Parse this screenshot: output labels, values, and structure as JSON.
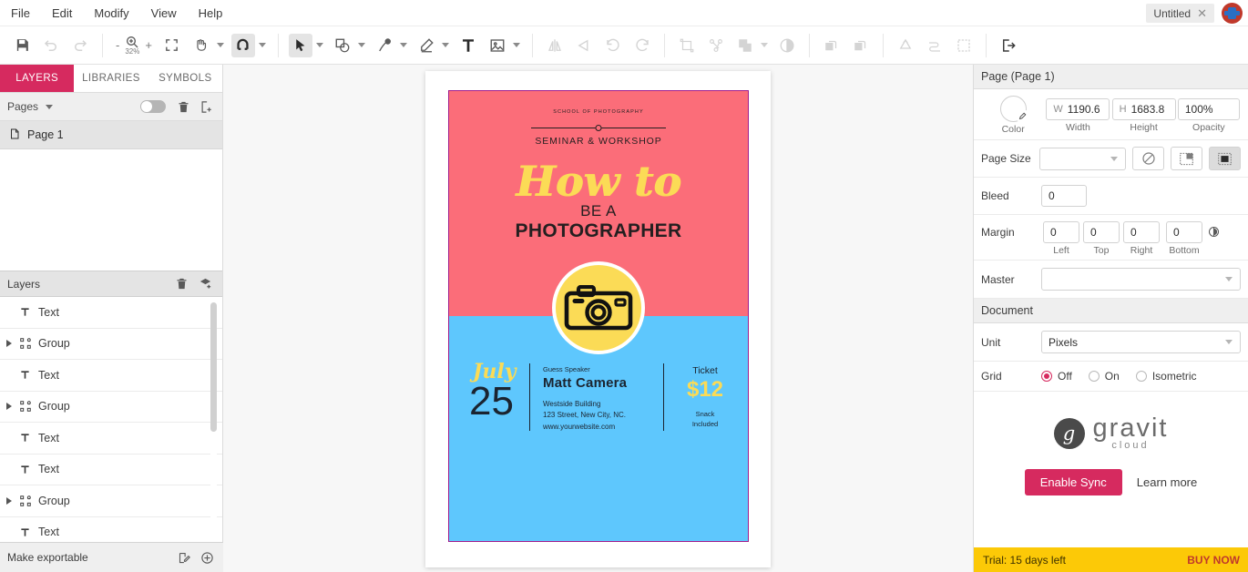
{
  "menubar": {
    "items": [
      "File",
      "Edit",
      "Modify",
      "View",
      "Help"
    ],
    "document_tab": "Untitled",
    "close_glyph": "✕"
  },
  "toolbar": {
    "zoom_minus": "-",
    "zoom_level": "32%",
    "zoom_plus": "+",
    "icons": [
      "save-icon",
      "undo-icon",
      "redo-icon",
      "zoom-icon",
      "fit-icon",
      "hand-icon",
      "magnet-icon",
      "pointer-icon",
      "shape-icon",
      "pen-icon",
      "pencil-icon",
      "text-icon",
      "image-icon",
      "flip-h-icon",
      "flip-v-icon",
      "rotate-ccw-icon",
      "rotate-cw-icon",
      "transform-icon",
      "node-icon",
      "boolean-icon",
      "mask-icon",
      "group-icon",
      "ungroup-icon",
      "path-icon",
      "connect-icon",
      "slice-icon",
      "export-icon"
    ]
  },
  "left_panel": {
    "tabs": [
      {
        "label": "LAYERS",
        "active": true
      },
      {
        "label": "LIBRARIES",
        "active": false
      },
      {
        "label": "SYMBOLS",
        "active": false
      }
    ],
    "pages_label": "Pages",
    "page_item": "Page 1",
    "layers_label": "Layers",
    "layers": [
      {
        "type": "Text",
        "icon": "text-icon",
        "expandable": false
      },
      {
        "type": "Group",
        "icon": "group-icon",
        "expandable": true
      },
      {
        "type": "Text",
        "icon": "text-icon",
        "expandable": false
      },
      {
        "type": "Group",
        "icon": "group-icon",
        "expandable": true
      },
      {
        "type": "Text",
        "icon": "text-icon",
        "expandable": false
      },
      {
        "type": "Text",
        "icon": "text-icon",
        "expandable": false
      },
      {
        "type": "Group",
        "icon": "group-icon",
        "expandable": true
      },
      {
        "type": "Text",
        "icon": "text-icon",
        "expandable": false
      }
    ],
    "footer_label": "Make exportable"
  },
  "right_panel": {
    "page_section_title": "Page (Page 1)",
    "color_caption": "Color",
    "width": {
      "prefix": "W",
      "value": "1190.6",
      "caption": "Width"
    },
    "height": {
      "prefix": "H",
      "value": "1683.8",
      "caption": "Height"
    },
    "opacity": {
      "value": "100%",
      "caption": "Opacity"
    },
    "page_size_label": "Page Size",
    "page_size_value": "",
    "bleed_label": "Bleed",
    "bleed_value": "0",
    "margin_label": "Margin",
    "margins": [
      {
        "value": "0",
        "caption": "Left"
      },
      {
        "value": "0",
        "caption": "Top"
      },
      {
        "value": "0",
        "caption": "Right"
      },
      {
        "value": "0",
        "caption": "Bottom"
      }
    ],
    "master_label": "Master",
    "master_value": "",
    "document_section_title": "Document",
    "unit_label": "Unit",
    "unit_value": "Pixels",
    "grid_label": "Grid",
    "grid_options": [
      {
        "label": "Off",
        "selected": true
      },
      {
        "label": "On",
        "selected": false
      },
      {
        "label": "Isometric",
        "selected": false
      }
    ],
    "cloud": {
      "logo_mark": "g",
      "logo_word": "gravit",
      "logo_sub": "cloud",
      "sync_button": "Enable Sync",
      "learn_more": "Learn more"
    },
    "trial": {
      "text": "Trial: 15 days left",
      "cta": "BUY NOW"
    }
  },
  "poster": {
    "colors": {
      "pink": "#fb6d79",
      "blue": "#5ec7fd",
      "yellow": "#fbdb56",
      "dark": "#241f20"
    },
    "school": "SCHOOL OF PHOTOGRAPHY",
    "seminar": "SEMINAR & WORKSHOP",
    "howto": "How to",
    "be_a": "BE A",
    "photographer": "PHOTOGRAPHER",
    "date_month": "July",
    "date_day": "25",
    "speaker_label": "Guess Speaker",
    "speaker_name": "Matt Camera",
    "address_line1": "Westside Building",
    "address_line2": "123 Street, New City,  NC.",
    "address_line3": "www.yourwebsite.com",
    "ticket_label": "Ticket",
    "ticket_price": "$12",
    "ticket_note_1": "Snack",
    "ticket_note_2": "Included"
  }
}
